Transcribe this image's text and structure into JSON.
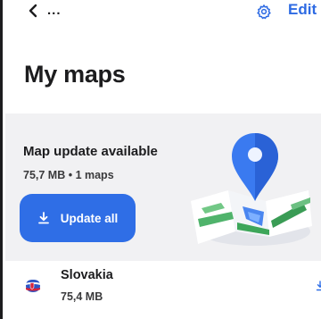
{
  "header": {
    "back_label": "...",
    "edit_label": "Edit"
  },
  "page": {
    "title": "My maps"
  },
  "update_card": {
    "title": "Map update available",
    "subtitle": "75,7 MB • 1 maps",
    "button_label": "Update all",
    "button_icon": "download-icon",
    "illustration": "map-pin-illustration"
  },
  "maps": [
    {
      "name": "Slovakia",
      "size": "75,4 MB",
      "flag": "slovakia-flag"
    }
  ],
  "colors": {
    "accent": "#2f6ee6",
    "card_bg": "#f1f1f3",
    "text": "#1c1c1e"
  }
}
